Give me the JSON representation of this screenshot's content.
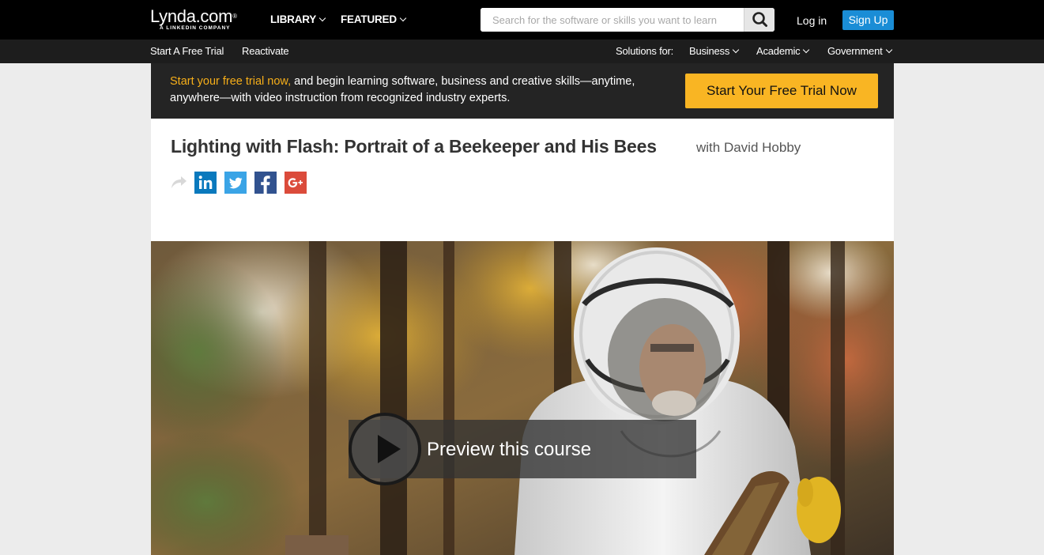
{
  "header": {
    "logo_text": "Lynda.com",
    "logo_subtext": "A LINKEDIN COMPANY",
    "nav": [
      {
        "label": "LIBRARY"
      },
      {
        "label": "FEATURED"
      }
    ],
    "search_placeholder": "Search for the software or skills you want to learn",
    "login_label": "Log in",
    "signup_label": "Sign Up"
  },
  "subnav": {
    "left": [
      {
        "label": "Start A Free Trial"
      },
      {
        "label": "Reactivate"
      }
    ],
    "solutions_label": "Solutions for:",
    "solutions": [
      {
        "label": "Business"
      },
      {
        "label": "Academic"
      },
      {
        "label": "Government"
      }
    ]
  },
  "promo": {
    "link_text": "Start your free trial now,",
    "body_text": " and begin learning software, business and creative skills—anytime, anywhere—with video instruction from recognized industry experts.",
    "button_label": "Start Your Free Trial Now"
  },
  "course": {
    "title": "Lighting with Flash: Portrait of a Beekeeper and His Bees",
    "author": "with David Hobby"
  },
  "social": [
    {
      "icon": "linkedin-icon",
      "glyph": "in",
      "color": "#0a79bd"
    },
    {
      "icon": "twitter-icon",
      "glyph": "",
      "color": "#3aa4e6"
    },
    {
      "icon": "facebook-icon",
      "glyph": "f",
      "color": "#31528f"
    },
    {
      "icon": "google-plus-icon",
      "glyph": "G+",
      "color": "#db4b3b"
    }
  ],
  "video": {
    "preview_label": "Preview this course"
  },
  "colors": {
    "accent_blue": "#1a8dd6",
    "promo_orange": "#f6ae19",
    "cta_yellow": "#f9b523"
  }
}
